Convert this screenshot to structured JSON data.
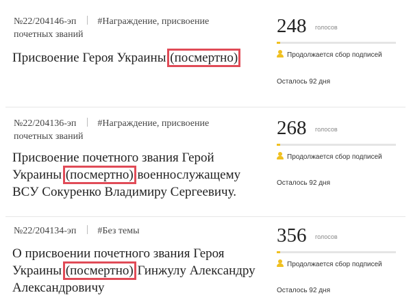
{
  "petitions": [
    {
      "number": "№22/204146-эп",
      "tag": "#Награждение, присвоение почетных званий",
      "title_before": "Присвоение Героя Украины ",
      "title_highlight": "(посмертно)",
      "title_after": "",
      "votes": "248",
      "votes_unit": "голосов",
      "progress_fraction": 0.004,
      "status": "Продолжается сбор подписей",
      "remaining": "Осталось 92 дня"
    },
    {
      "number": "№22/204136-эп",
      "tag": "#Награждение, присвоение почетных званий",
      "title_before": "Присвоение почетного звания Герой Украины ",
      "title_highlight": "(посмертно)",
      "title_after": " военнослужащему ВСУ Сокуренко Владимиру Сергеевичу.",
      "votes": "268",
      "votes_unit": "голосов",
      "progress_fraction": 0.005,
      "status": "Продолжается сбор подписей",
      "remaining": "Осталось 92 дня"
    },
    {
      "number": "№22/204134-эп",
      "tag": "#Без темы",
      "title_before": "О присвоении почетного звания Героя Украины ",
      "title_highlight": "(посмертно)",
      "title_after": " Гинжулу Александру Александровичу",
      "votes": "356",
      "votes_unit": "голосов",
      "progress_fraction": 0.007,
      "status": "Продолжается сбор подписей",
      "remaining": "Осталось 92 дня"
    }
  ],
  "colors": {
    "accent": "#f0c020",
    "highlight_box": "#e04b57",
    "divider": "#e6e6e6"
  },
  "icons": {
    "status_icon": "person-icon"
  }
}
